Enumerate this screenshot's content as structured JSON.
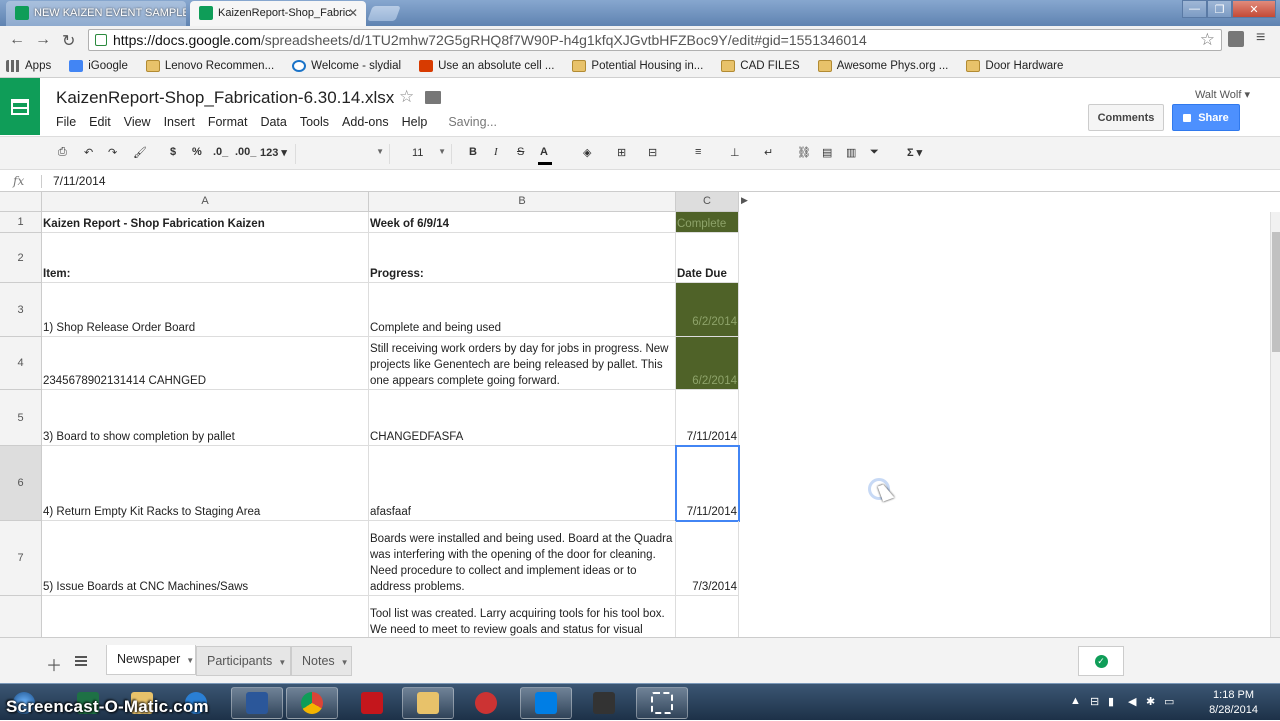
{
  "browser": {
    "tabs": [
      {
        "label": "NEW KAIZEN EVENT SAMPLE",
        "active": false
      },
      {
        "label": "KaizenReport-Shop_Fabric",
        "active": true
      }
    ],
    "url_host": "https://docs.google.com",
    "url_path": "/spreadsheets/d/1TU2mhw72G5gRHQ8f7W90P-h4g1kfqXJGvtbHFZBoc9Y/edit#gid=1551346014",
    "bookmarks": [
      {
        "label": "Apps",
        "icon": "apps-icon"
      },
      {
        "label": "iGoogle",
        "icon": "google-icon"
      },
      {
        "label": "Lenovo Recommen...",
        "icon": "folder-icon"
      },
      {
        "label": "Welcome - slydial",
        "icon": "globe-icon"
      },
      {
        "label": "Use an absolute cell ...",
        "icon": "office-icon"
      },
      {
        "label": "Potential Housing in...",
        "icon": "folder-icon"
      },
      {
        "label": "CAD FILES",
        "icon": "folder-icon"
      },
      {
        "label": "Awesome Phys.org ...",
        "icon": "folder-icon"
      },
      {
        "label": "Door Hardware",
        "icon": "folder-icon"
      }
    ]
  },
  "doc": {
    "title": "KaizenReport-Shop_Fabrication-6.30.14.xlsx",
    "menu": [
      "File",
      "Edit",
      "View",
      "Insert",
      "Format",
      "Data",
      "Tools",
      "Add-ons",
      "Help"
    ],
    "status": "Saving...",
    "user": "Walt Wolf",
    "comments_label": "Comments",
    "share_label": "Share"
  },
  "format_toolbar": {
    "currency": "$",
    "percent": "%",
    "decrease_decimal": ".0_",
    "increase_decimal": ".00_",
    "more_formats": "123",
    "font_size": "11",
    "bold": "B",
    "italic": "I",
    "strike": "S",
    "text_color": "A",
    "functions": "Σ"
  },
  "formula_bar": {
    "fx_label": "fx",
    "value": "7/11/2014"
  },
  "grid": {
    "columns": [
      "A",
      "B",
      "C"
    ],
    "rows": [
      {
        "num": "1",
        "a": "Kaizen Report - Shop Fabrication Kaizen",
        "b": "Week of 6/9/14",
        "c": "Complete"
      },
      {
        "num": "2",
        "a": "Item:",
        "b": "Progress:",
        "c": "Date Due"
      },
      {
        "num": "3",
        "a": "1) Shop Release Order Board",
        "b": "Complete and being used",
        "c": "6/2/2014"
      },
      {
        "num": "4",
        "a": "2345678902131414 CAHNGED",
        "b": "Still receiving work orders by day for jobs in progress. New projects like Genentech are being released by pallet. This one appears complete going forward.",
        "c": "6/2/2014"
      },
      {
        "num": "5",
        "a": "3) Board to show completion by pallet",
        "b": "CHANGEDFASFA",
        "c": "7/11/2014"
      },
      {
        "num": "6",
        "a": "4) Return Empty Kit Racks to Staging Area",
        "b": "afasfaaf",
        "c": "7/11/2014"
      },
      {
        "num": "7",
        "a": "5) Issue Boards at CNC Machines/Saws",
        "b": "Boards were installed and being used. Board at the Quadra was interfering with the opening of the door for cleaning. Need procedure to collect and implement ideas or to address problems.",
        "c": "7/3/2014"
      },
      {
        "num": "",
        "a": "",
        "b": "Tool list was created. Larry acquiring tools for his tool box. We need to meet to review goals and status for visual",
        "c": ""
      }
    ],
    "selected_cell": "C6"
  },
  "sheets": {
    "tabs": [
      "Newspaper",
      "Participants",
      "Notes"
    ],
    "active": "Newspaper"
  },
  "taskbar": {
    "watermark": "Screencast-O-Matic.com",
    "time": "1:18 PM",
    "date": "8/28/2014"
  },
  "colors": {
    "sheets_green": "#0f9d58",
    "share_blue": "#4d90fe",
    "complete_fill": "#4f6228",
    "selection": "#4285f4"
  }
}
